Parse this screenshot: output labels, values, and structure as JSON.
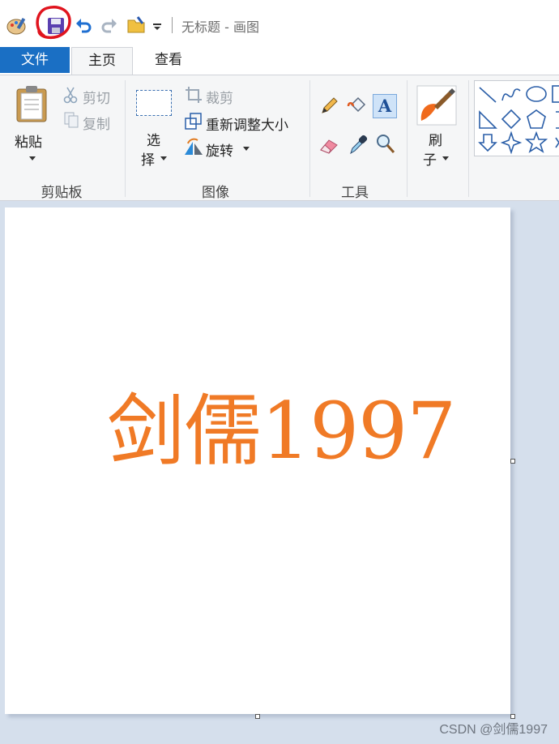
{
  "window": {
    "title": "无标题 - 画图"
  },
  "tabs": {
    "file": "文件",
    "home": "主页",
    "view": "查看"
  },
  "clipboard": {
    "paste": "粘贴",
    "cut": "剪切",
    "copy": "复制",
    "group_label": "剪贴板"
  },
  "image": {
    "select_line1": "选",
    "select_line2": "择",
    "crop": "裁剪",
    "resize": "重新调整大小",
    "rotate": "旋转",
    "group_label": "图像"
  },
  "tools": {
    "group_label": "工具"
  },
  "brushes": {
    "label_line1": "刷",
    "label_line2": "子"
  },
  "canvas": {
    "text": "剑儒1997",
    "text_color": "#f07a26"
  },
  "watermark": "CSDN @剑儒1997",
  "colors": {
    "file_tab": "#1a6fc4",
    "ribbon_bg": "#f5f6f7",
    "workspace_bg": "#d5dfec",
    "annotation": "#e0141e"
  }
}
